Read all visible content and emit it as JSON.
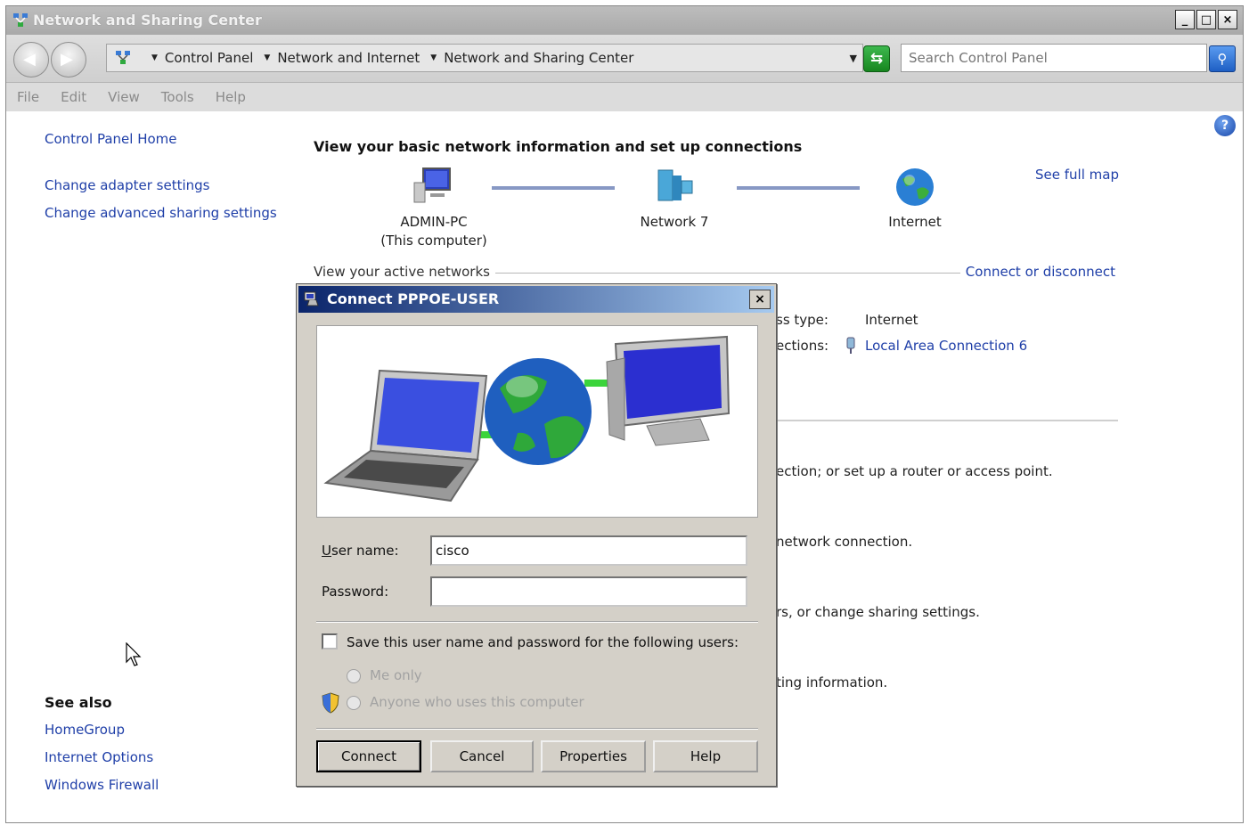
{
  "window": {
    "title": "Network and Sharing Center",
    "caption_buttons": [
      "_",
      "□",
      "×"
    ]
  },
  "address": {
    "crumbs": [
      "Control Panel",
      "Network and Internet",
      "Network and Sharing Center"
    ],
    "search_placeholder": "Search Control Panel"
  },
  "menu": [
    "File",
    "Edit",
    "View",
    "Tools",
    "Help"
  ],
  "sidebar": {
    "home": "Control Panel Home",
    "items": [
      "Change adapter settings",
      "Change advanced sharing settings"
    ],
    "see_also_title": "See also",
    "see_also": [
      "HomeGroup",
      "Internet Options",
      "Windows Firewall"
    ]
  },
  "main": {
    "title": "View your basic network information and set up connections",
    "nodes": [
      {
        "label": "ADMIN-PC",
        "sub": "(This computer)"
      },
      {
        "label": "Network  7",
        "sub": ""
      },
      {
        "label": "Internet",
        "sub": ""
      }
    ],
    "see_full_map": "See full map",
    "active_label": "View your active networks",
    "connect_disconnect": "Connect or disconnect",
    "access_type_label": "ss type:",
    "access_type_value": "Internet",
    "connections_label": "ections:",
    "connections_value": "Local Area Connection 6",
    "partial_lines": [
      "ection; or set up a router or access point.",
      "network connection.",
      "rs, or change sharing settings.",
      "ting information."
    ]
  },
  "dialog": {
    "title": "Connect PPPOE-USER",
    "close": "×",
    "username_label": "User name:",
    "username_value": "cisco",
    "password_label": "Password:",
    "password_value": "",
    "save_label": "Save this user name and password for the following users:",
    "me_only": "Me only",
    "anyone": "Anyone who uses this computer",
    "buttons": {
      "connect": "Connect",
      "cancel": "Cancel",
      "properties": "Properties",
      "help": "Help"
    }
  },
  "colors": {
    "link": "#1f3fa8",
    "dialog_title_start": "#0a246a",
    "dialog_title_end": "#a6caf0"
  },
  "icons": [
    "network-icon",
    "computer-icon",
    "network-building-icon",
    "globe-icon",
    "help-icon",
    "shield-icon",
    "cursor-icon",
    "adapter-icon"
  ]
}
